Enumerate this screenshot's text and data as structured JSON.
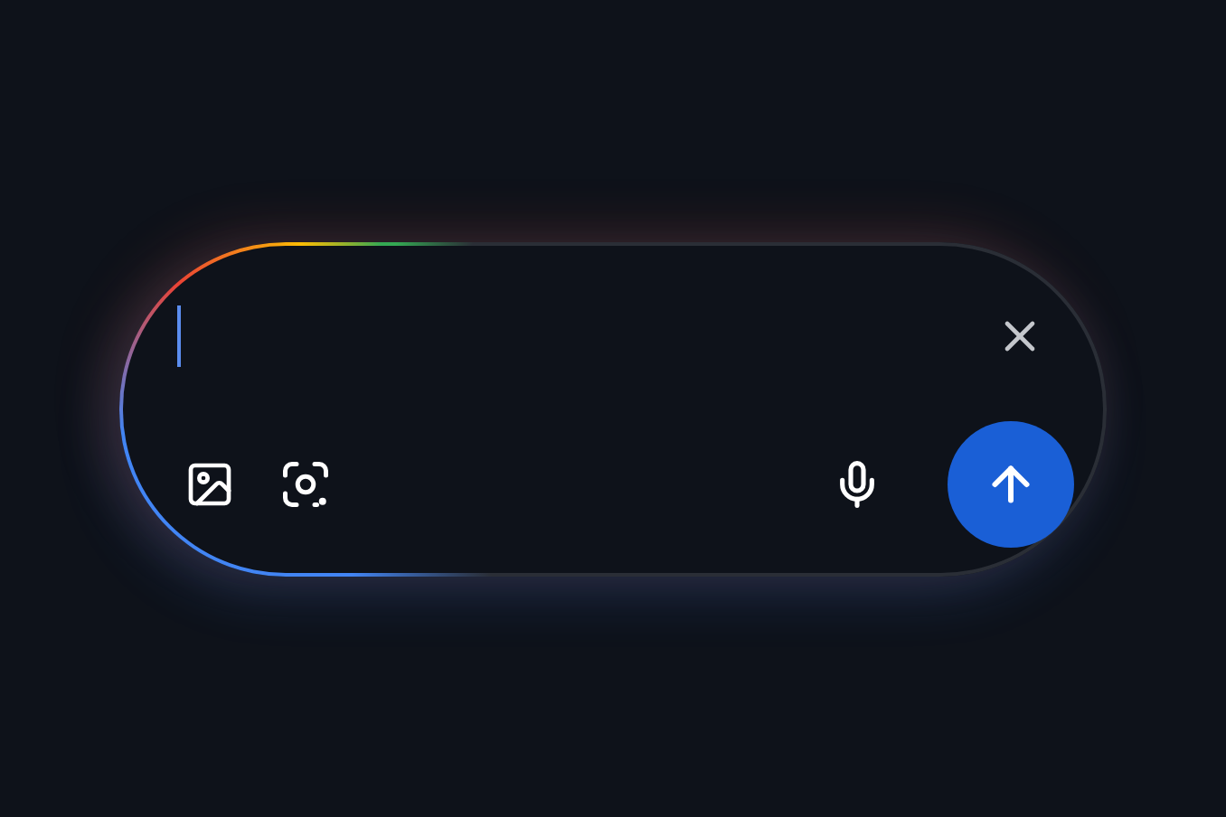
{
  "search": {
    "focused": true
  }
}
